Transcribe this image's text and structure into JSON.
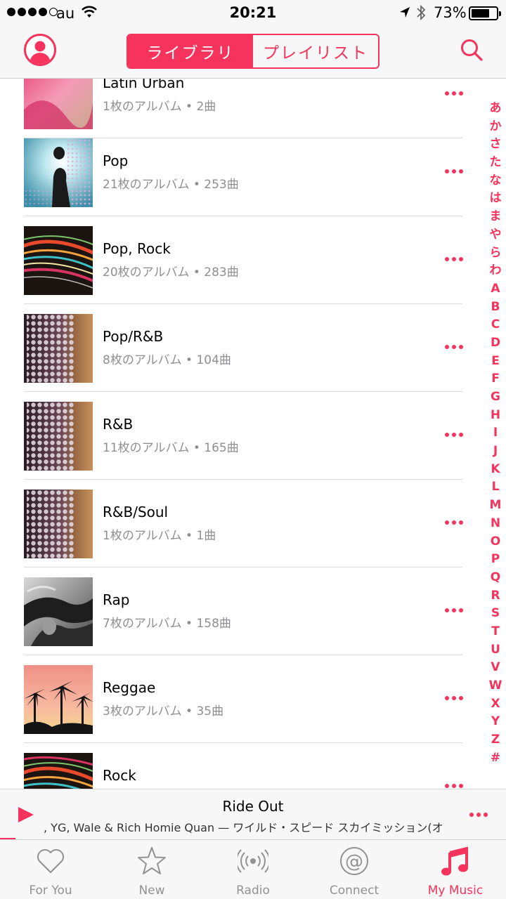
{
  "status_bar": {
    "carrier": "au",
    "time": "20:21",
    "battery_percent_text": "73%",
    "battery_level": 0.73
  },
  "nav": {
    "segments": [
      {
        "label": "ライブラリ",
        "active": true
      },
      {
        "label": "プレイリスト",
        "active": false
      }
    ]
  },
  "genres": [
    {
      "title": "Latin Urban",
      "subtitle": "1枚のアルバム • 2曲"
    },
    {
      "title": "Pop",
      "subtitle": "21枚のアルバム • 253曲"
    },
    {
      "title": "Pop, Rock",
      "subtitle": "20枚のアルバム • 283曲"
    },
    {
      "title": "Pop/R&B",
      "subtitle": "8枚のアルバム • 104曲"
    },
    {
      "title": "R&B",
      "subtitle": "11枚のアルバム • 165曲"
    },
    {
      "title": "R&B/Soul",
      "subtitle": "1枚のアルバム • 1曲"
    },
    {
      "title": "Rap",
      "subtitle": "7枚のアルバム • 158曲"
    },
    {
      "title": "Reggae",
      "subtitle": "3枚のアルバム • 35曲"
    },
    {
      "title": "Rock",
      "subtitle": ""
    }
  ],
  "index_letters": [
    "あ",
    "か",
    "さ",
    "た",
    "な",
    "は",
    "ま",
    "や",
    "ら",
    "わ",
    "A",
    "B",
    "C",
    "D",
    "E",
    "F",
    "G",
    "H",
    "I",
    "J",
    "K",
    "L",
    "M",
    "N",
    "O",
    "P",
    "Q",
    "R",
    "S",
    "T",
    "U",
    "V",
    "W",
    "X",
    "Y",
    "Z",
    "#"
  ],
  "now_playing": {
    "title": "Ride Out",
    "subtitle": ", YG, Wale & Rich Homie Quan — ワイルド・スピード スカイミッション(オ",
    "progress": 0.03
  },
  "tabs": [
    {
      "label": "For You",
      "icon": "heart-icon",
      "active": false
    },
    {
      "label": "New",
      "icon": "star-icon",
      "active": false
    },
    {
      "label": "Radio",
      "icon": "radio-icon",
      "active": false
    },
    {
      "label": "Connect",
      "icon": "at-icon",
      "active": false
    },
    {
      "label": "My Music",
      "icon": "music-note-icon",
      "active": true
    }
  ],
  "colors": {
    "accent": "#f5335c",
    "bar_background": "#f7f7f7",
    "secondary_text": "#8e8e93"
  }
}
